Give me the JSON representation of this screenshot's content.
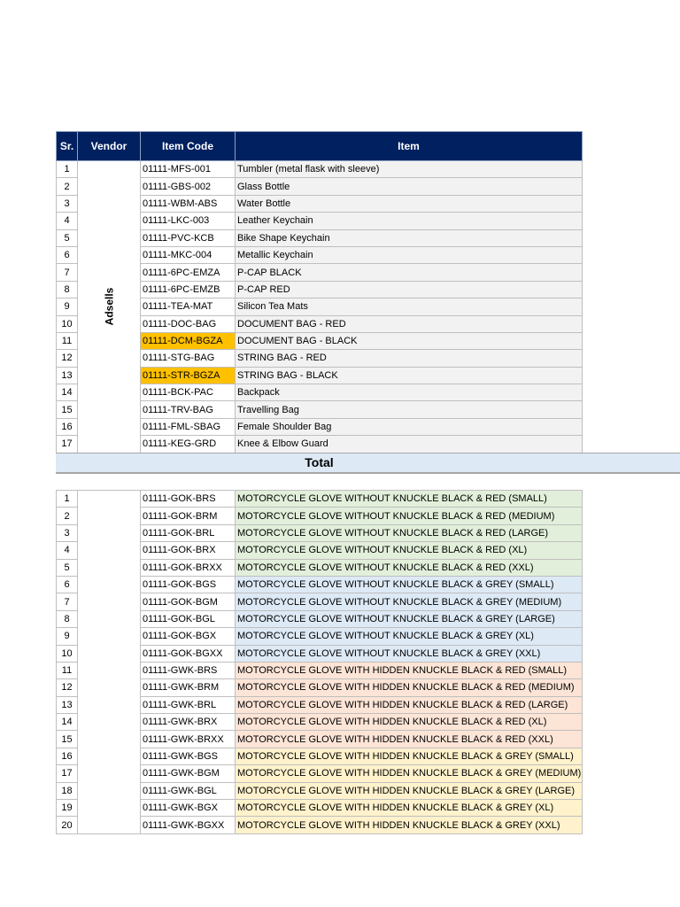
{
  "headers": {
    "sr": "Sr.",
    "vendor": "Vendor",
    "code": "Item Code",
    "item": "Item"
  },
  "vendor": "Adsells",
  "table1": [
    {
      "sr": "1",
      "code": "01111-MFS-001",
      "item": "Tumbler (metal flask with sleeve)"
    },
    {
      "sr": "2",
      "code": "01111-GBS-002",
      "item": "Glass Bottle"
    },
    {
      "sr": "3",
      "code": "01111-WBM-ABS",
      "item": "Water Bottle"
    },
    {
      "sr": "4",
      "code": "01111-LKC-003",
      "item": "Leather Keychain"
    },
    {
      "sr": "5",
      "code": "01111-PVC-KCB",
      "item": "Bike Shape Keychain"
    },
    {
      "sr": "6",
      "code": "01111-MKC-004",
      "item": "Metallic Keychain"
    },
    {
      "sr": "7",
      "code": "01111-6PC-EMZA",
      "item": "P-CAP BLACK"
    },
    {
      "sr": "8",
      "code": "01111-6PC-EMZB",
      "item": "P-CAP RED"
    },
    {
      "sr": "9",
      "code": "01111-TEA-MAT",
      "item": "Silicon Tea Mats"
    },
    {
      "sr": "10",
      "code": "01111-DOC-BAG",
      "item": "DOCUMENT BAG - RED"
    },
    {
      "sr": "11",
      "code": "01111-DCM-BGZA",
      "item": "DOCUMENT BAG - BLACK",
      "highlight": true
    },
    {
      "sr": "12",
      "code": "01111-STG-BAG",
      "item": "STRING BAG - RED"
    },
    {
      "sr": "13",
      "code": "01111-STR-BGZA",
      "item": "STRING BAG - BLACK",
      "highlight": true
    },
    {
      "sr": "14",
      "code": "01111-BCK-PAC",
      "item": "Backpack"
    },
    {
      "sr": "15",
      "code": "01111-TRV-BAG",
      "item": "Travelling Bag"
    },
    {
      "sr": "16",
      "code": "01111-FML-SBAG",
      "item": "Female Shoulder Bag"
    },
    {
      "sr": "17",
      "code": "01111-KEG-GRD",
      "item": "Knee & Elbow Guard"
    }
  ],
  "total_label": "Total",
  "table2": [
    {
      "sr": "1",
      "code": "01111-GOK-BRS",
      "item": "MOTORCYCLE GLOVE WITHOUT KNUCKLE BLACK & RED (SMALL)",
      "color": "g"
    },
    {
      "sr": "2",
      "code": "01111-GOK-BRM",
      "item": "MOTORCYCLE GLOVE WITHOUT KNUCKLE BLACK & RED (MEDIUM)",
      "color": "g"
    },
    {
      "sr": "3",
      "code": "01111-GOK-BRL",
      "item": "MOTORCYCLE GLOVE WITHOUT KNUCKLE BLACK & RED (LARGE)",
      "color": "g"
    },
    {
      "sr": "4",
      "code": "01111-GOK-BRX",
      "item": "MOTORCYCLE GLOVE WITHOUT KNUCKLE BLACK & RED (XL)",
      "color": "g"
    },
    {
      "sr": "5",
      "code": "01111-GOK-BRXX",
      "item": "MOTORCYCLE GLOVE WITHOUT KNUCKLE BLACK & RED (XXL)",
      "color": "g"
    },
    {
      "sr": "6",
      "code": "01111-GOK-BGS",
      "item": "MOTORCYCLE GLOVE WITHOUT KNUCKLE BLACK & GREY (SMALL)",
      "color": "b"
    },
    {
      "sr": "7",
      "code": "01111-GOK-BGM",
      "item": "MOTORCYCLE GLOVE WITHOUT KNUCKLE BLACK & GREY (MEDIUM)",
      "color": "b"
    },
    {
      "sr": "8",
      "code": "01111-GOK-BGL",
      "item": "MOTORCYCLE GLOVE WITHOUT KNUCKLE BLACK & GREY (LARGE)",
      "color": "b"
    },
    {
      "sr": "9",
      "code": "01111-GOK-BGX",
      "item": "MOTORCYCLE GLOVE WITHOUT KNUCKLE BLACK & GREY (XL)",
      "color": "b"
    },
    {
      "sr": "10",
      "code": "01111-GOK-BGXX",
      "item": "MOTORCYCLE GLOVE WITHOUT KNUCKLE BLACK & GREY (XXL)",
      "color": "b"
    },
    {
      "sr": "11",
      "code": "01111-GWK-BRS",
      "item": "MOTORCYCLE GLOVE WITH HIDDEN KNUCKLE BLACK & RED (SMALL)",
      "color": "p"
    },
    {
      "sr": "12",
      "code": "01111-GWK-BRM",
      "item": "MOTORCYCLE GLOVE WITH HIDDEN KNUCKLE BLACK & RED (MEDIUM)",
      "color": "p"
    },
    {
      "sr": "13",
      "code": "01111-GWK-BRL",
      "item": "MOTORCYCLE GLOVE WITH HIDDEN KNUCKLE BLACK & RED (LARGE)",
      "color": "p"
    },
    {
      "sr": "14",
      "code": "01111-GWK-BRX",
      "item": "MOTORCYCLE GLOVE WITH HIDDEN KNUCKLE BLACK & RED (XL)",
      "color": "p"
    },
    {
      "sr": "15",
      "code": "01111-GWK-BRXX",
      "item": "MOTORCYCLE GLOVE WITH HIDDEN KNUCKLE BLACK & RED (XXL)",
      "color": "p"
    },
    {
      "sr": "16",
      "code": "01111-GWK-BGS",
      "item": "MOTORCYCLE GLOVE WITH HIDDEN KNUCKLE BLACK & GREY (SMALL)",
      "color": "y"
    },
    {
      "sr": "17",
      "code": "01111-GWK-BGM",
      "item": "MOTORCYCLE GLOVE WITH HIDDEN KNUCKLE BLACK & GREY (MEDIUM)",
      "color": "y"
    },
    {
      "sr": "18",
      "code": "01111-GWK-BGL",
      "item": "MOTORCYCLE GLOVE WITH HIDDEN KNUCKLE BLACK & GREY (LARGE)",
      "color": "y"
    },
    {
      "sr": "19",
      "code": "01111-GWK-BGX",
      "item": "MOTORCYCLE GLOVE WITH HIDDEN KNUCKLE BLACK & GREY (XL)",
      "color": "y"
    },
    {
      "sr": "20",
      "code": "01111-GWK-BGXX",
      "item": "MOTORCYCLE GLOVE WITH HIDDEN KNUCKLE BLACK & GREY (XXL)",
      "color": "y"
    }
  ]
}
